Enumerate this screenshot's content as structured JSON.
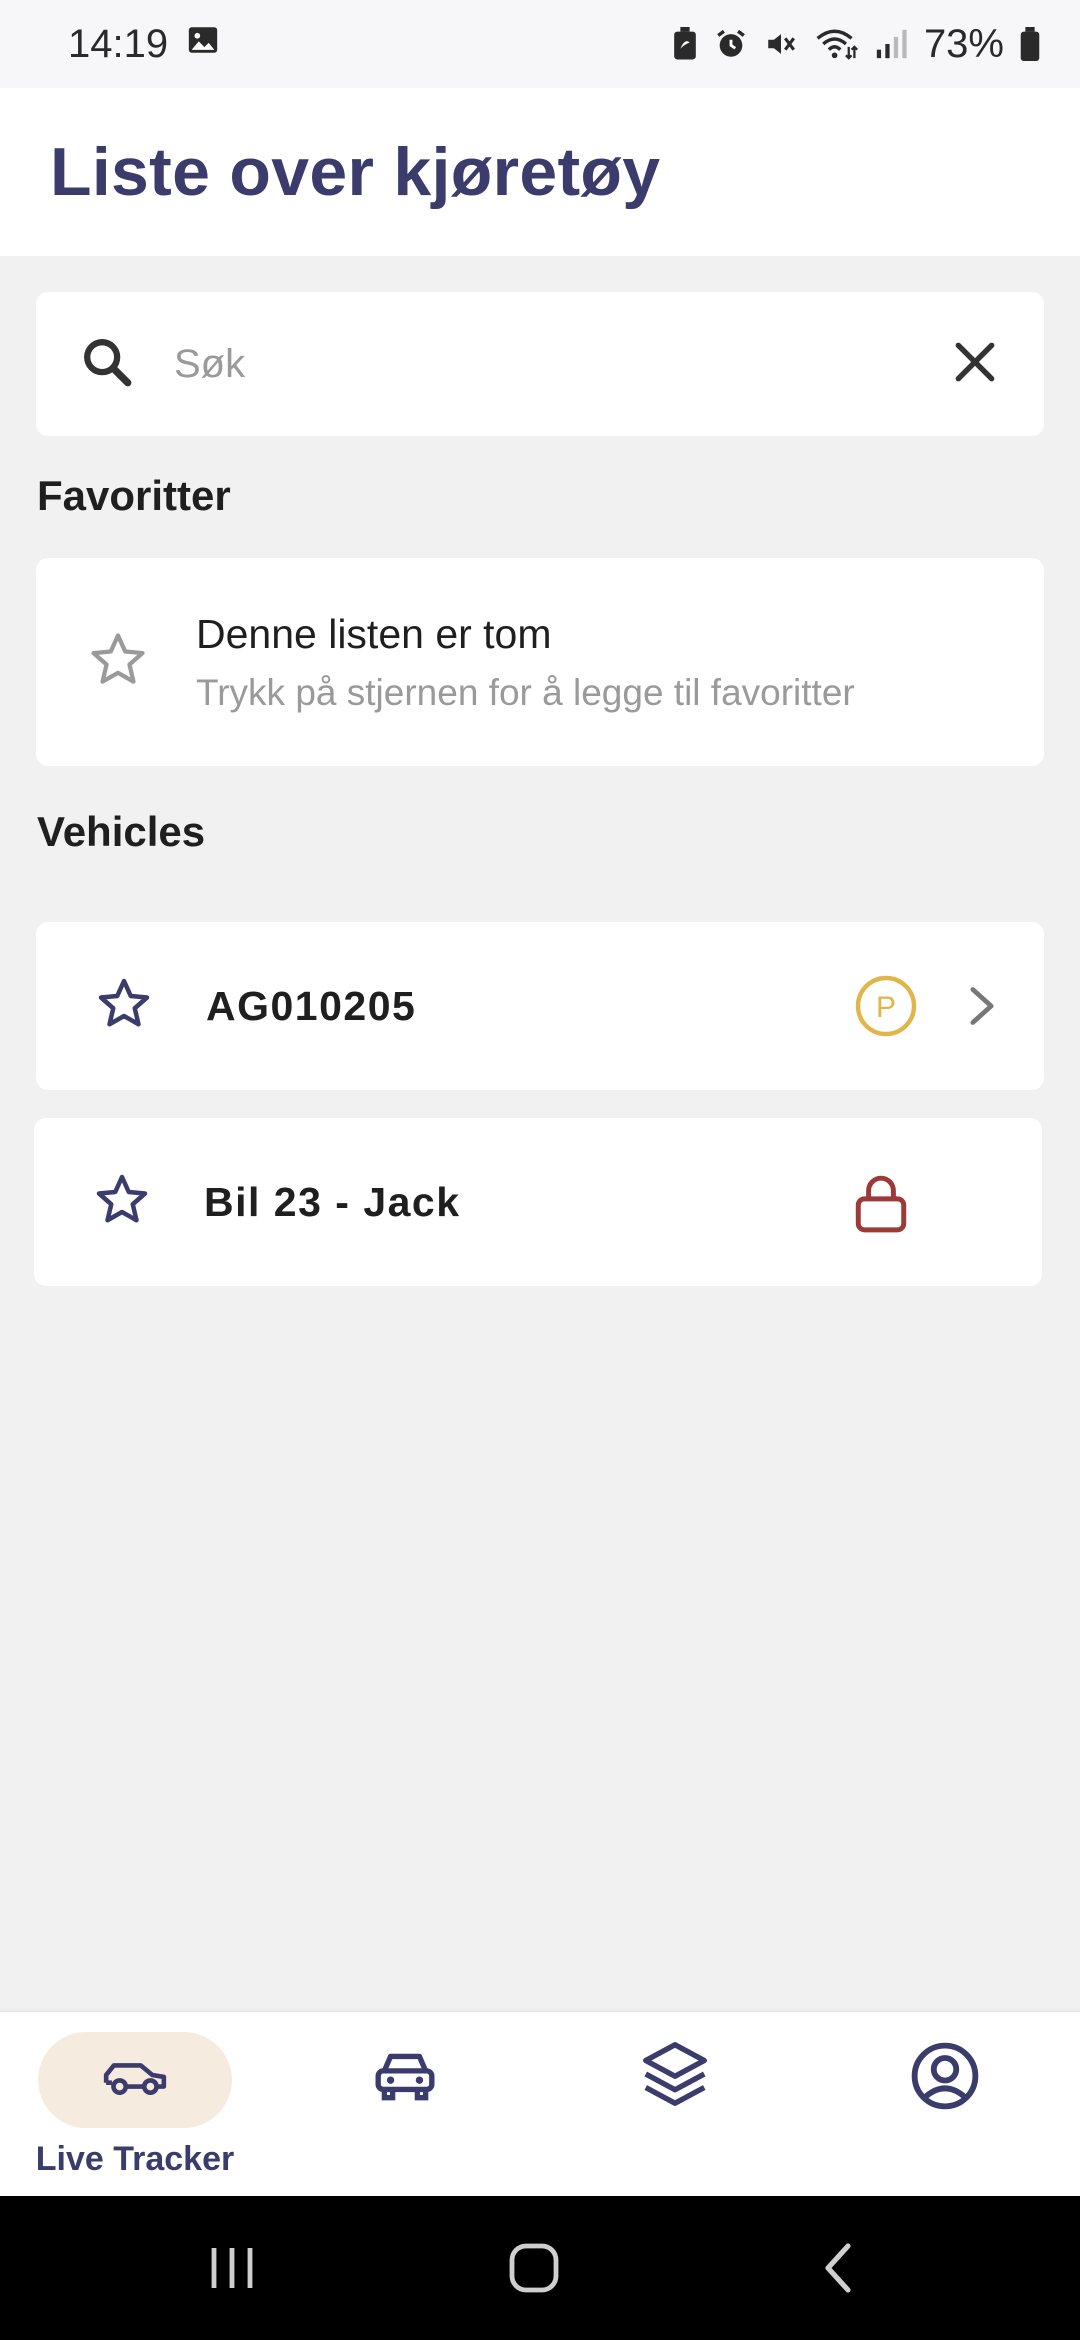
{
  "status_bar": {
    "time": "14:19",
    "battery": "73%",
    "icons": [
      "image-icon",
      "battery-saver-icon",
      "alarm-icon",
      "mute-icon",
      "wifi-icon",
      "signal-icon",
      "battery-icon"
    ]
  },
  "header": {
    "title": "Liste over kjøretøy"
  },
  "search": {
    "placeholder": "Søk",
    "value": ""
  },
  "favorites": {
    "section_title": "Favoritter",
    "empty_title": "Denne listen er tom",
    "empty_subtitle": "Trykk på stjernen for å legge til favoritter"
  },
  "vehicles": {
    "section_title": "Vehicles",
    "items": [
      {
        "name": "AG010205",
        "status_icon": "parking-icon",
        "status_letter": "P",
        "status_color": "#e0b54a",
        "has_chevron": true
      },
      {
        "name": "Bil 23 - Jack",
        "status_icon": "lock-icon",
        "status_color": "#9b3a38",
        "has_chevron": false
      }
    ]
  },
  "bottom_nav": {
    "items": [
      {
        "label": "Live Tracker",
        "icon": "car-outline-icon",
        "active": true
      },
      {
        "label": "",
        "icon": "car-front-icon",
        "active": false
      },
      {
        "label": "",
        "icon": "layers-icon",
        "active": false
      },
      {
        "label": "",
        "icon": "account-icon",
        "active": false
      }
    ]
  },
  "colors": {
    "accent": "#3b3c6c",
    "background": "#f1f1f1",
    "active_pill": "#f6ebdf",
    "parking": "#e0b54a",
    "lock": "#9b3a38"
  }
}
